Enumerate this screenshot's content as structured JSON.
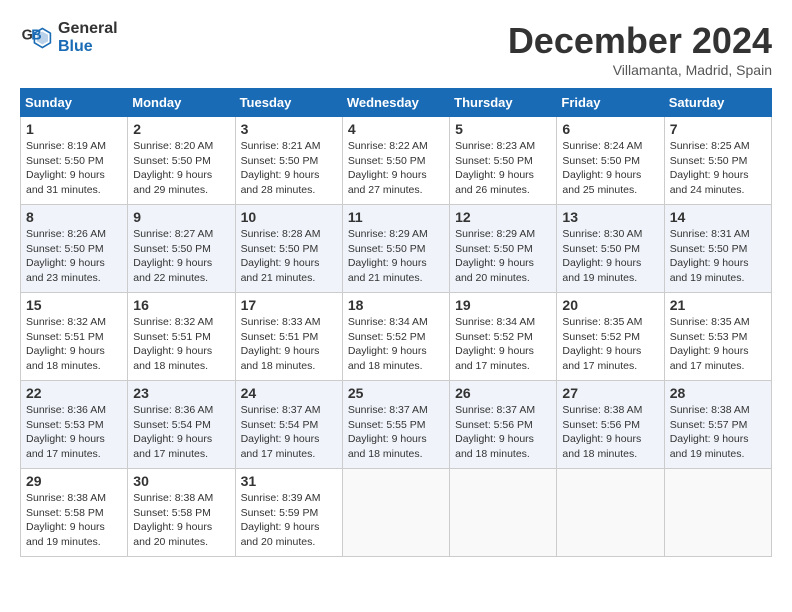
{
  "logo": {
    "line1": "General",
    "line2": "Blue"
  },
  "title": "December 2024",
  "subtitle": "Villamanta, Madrid, Spain",
  "days_of_week": [
    "Sunday",
    "Monday",
    "Tuesday",
    "Wednesday",
    "Thursday",
    "Friday",
    "Saturday"
  ],
  "weeks": [
    [
      {
        "day": "1",
        "info": "Sunrise: 8:19 AM\nSunset: 5:50 PM\nDaylight: 9 hours\nand 31 minutes."
      },
      {
        "day": "2",
        "info": "Sunrise: 8:20 AM\nSunset: 5:50 PM\nDaylight: 9 hours\nand 29 minutes."
      },
      {
        "day": "3",
        "info": "Sunrise: 8:21 AM\nSunset: 5:50 PM\nDaylight: 9 hours\nand 28 minutes."
      },
      {
        "day": "4",
        "info": "Sunrise: 8:22 AM\nSunset: 5:50 PM\nDaylight: 9 hours\nand 27 minutes."
      },
      {
        "day": "5",
        "info": "Sunrise: 8:23 AM\nSunset: 5:50 PM\nDaylight: 9 hours\nand 26 minutes."
      },
      {
        "day": "6",
        "info": "Sunrise: 8:24 AM\nSunset: 5:50 PM\nDaylight: 9 hours\nand 25 minutes."
      },
      {
        "day": "7",
        "info": "Sunrise: 8:25 AM\nSunset: 5:50 PM\nDaylight: 9 hours\nand 24 minutes."
      }
    ],
    [
      {
        "day": "8",
        "info": "Sunrise: 8:26 AM\nSunset: 5:50 PM\nDaylight: 9 hours\nand 23 minutes."
      },
      {
        "day": "9",
        "info": "Sunrise: 8:27 AM\nSunset: 5:50 PM\nDaylight: 9 hours\nand 22 minutes."
      },
      {
        "day": "10",
        "info": "Sunrise: 8:28 AM\nSunset: 5:50 PM\nDaylight: 9 hours\nand 21 minutes."
      },
      {
        "day": "11",
        "info": "Sunrise: 8:29 AM\nSunset: 5:50 PM\nDaylight: 9 hours\nand 21 minutes."
      },
      {
        "day": "12",
        "info": "Sunrise: 8:29 AM\nSunset: 5:50 PM\nDaylight: 9 hours\nand 20 minutes."
      },
      {
        "day": "13",
        "info": "Sunrise: 8:30 AM\nSunset: 5:50 PM\nDaylight: 9 hours\nand 19 minutes."
      },
      {
        "day": "14",
        "info": "Sunrise: 8:31 AM\nSunset: 5:50 PM\nDaylight: 9 hours\nand 19 minutes."
      }
    ],
    [
      {
        "day": "15",
        "info": "Sunrise: 8:32 AM\nSunset: 5:51 PM\nDaylight: 9 hours\nand 18 minutes."
      },
      {
        "day": "16",
        "info": "Sunrise: 8:32 AM\nSunset: 5:51 PM\nDaylight: 9 hours\nand 18 minutes."
      },
      {
        "day": "17",
        "info": "Sunrise: 8:33 AM\nSunset: 5:51 PM\nDaylight: 9 hours\nand 18 minutes."
      },
      {
        "day": "18",
        "info": "Sunrise: 8:34 AM\nSunset: 5:52 PM\nDaylight: 9 hours\nand 18 minutes."
      },
      {
        "day": "19",
        "info": "Sunrise: 8:34 AM\nSunset: 5:52 PM\nDaylight: 9 hours\nand 17 minutes."
      },
      {
        "day": "20",
        "info": "Sunrise: 8:35 AM\nSunset: 5:52 PM\nDaylight: 9 hours\nand 17 minutes."
      },
      {
        "day": "21",
        "info": "Sunrise: 8:35 AM\nSunset: 5:53 PM\nDaylight: 9 hours\nand 17 minutes."
      }
    ],
    [
      {
        "day": "22",
        "info": "Sunrise: 8:36 AM\nSunset: 5:53 PM\nDaylight: 9 hours\nand 17 minutes."
      },
      {
        "day": "23",
        "info": "Sunrise: 8:36 AM\nSunset: 5:54 PM\nDaylight: 9 hours\nand 17 minutes."
      },
      {
        "day": "24",
        "info": "Sunrise: 8:37 AM\nSunset: 5:54 PM\nDaylight: 9 hours\nand 17 minutes."
      },
      {
        "day": "25",
        "info": "Sunrise: 8:37 AM\nSunset: 5:55 PM\nDaylight: 9 hours\nand 18 minutes."
      },
      {
        "day": "26",
        "info": "Sunrise: 8:37 AM\nSunset: 5:56 PM\nDaylight: 9 hours\nand 18 minutes."
      },
      {
        "day": "27",
        "info": "Sunrise: 8:38 AM\nSunset: 5:56 PM\nDaylight: 9 hours\nand 18 minutes."
      },
      {
        "day": "28",
        "info": "Sunrise: 8:38 AM\nSunset: 5:57 PM\nDaylight: 9 hours\nand 19 minutes."
      }
    ],
    [
      {
        "day": "29",
        "info": "Sunrise: 8:38 AM\nSunset: 5:58 PM\nDaylight: 9 hours\nand 19 minutes."
      },
      {
        "day": "30",
        "info": "Sunrise: 8:38 AM\nSunset: 5:58 PM\nDaylight: 9 hours\nand 20 minutes."
      },
      {
        "day": "31",
        "info": "Sunrise: 8:39 AM\nSunset: 5:59 PM\nDaylight: 9 hours\nand 20 minutes."
      },
      {
        "day": "",
        "info": ""
      },
      {
        "day": "",
        "info": ""
      },
      {
        "day": "",
        "info": ""
      },
      {
        "day": "",
        "info": ""
      }
    ]
  ]
}
